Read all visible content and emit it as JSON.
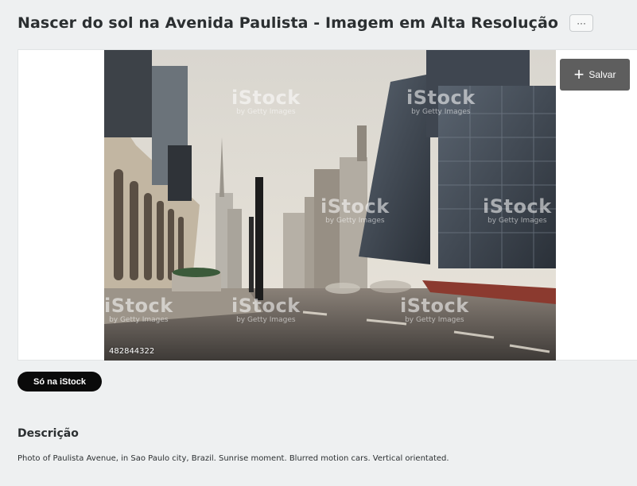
{
  "header": {
    "title": "Nascer do sol na Avenida Paulista - Imagem em Alta Resolução",
    "more_label": "···"
  },
  "viewer": {
    "save_label": "Salvar",
    "save_icon": "plus-icon",
    "image_id": "482844322",
    "watermark": {
      "brand": "iStock",
      "sub": "by Getty Images"
    }
  },
  "badge": {
    "label": "Só na iStock"
  },
  "description": {
    "heading": "Descrição",
    "text": "Photo of Paulista Avenue, in Sao Paulo city, Brazil. Sunrise moment. Blurred motion cars. Vertical orientated."
  },
  "colors": {
    "background": "#eef0f1",
    "save_button": "#5e5e5e",
    "badge": "#0a0a0a"
  }
}
